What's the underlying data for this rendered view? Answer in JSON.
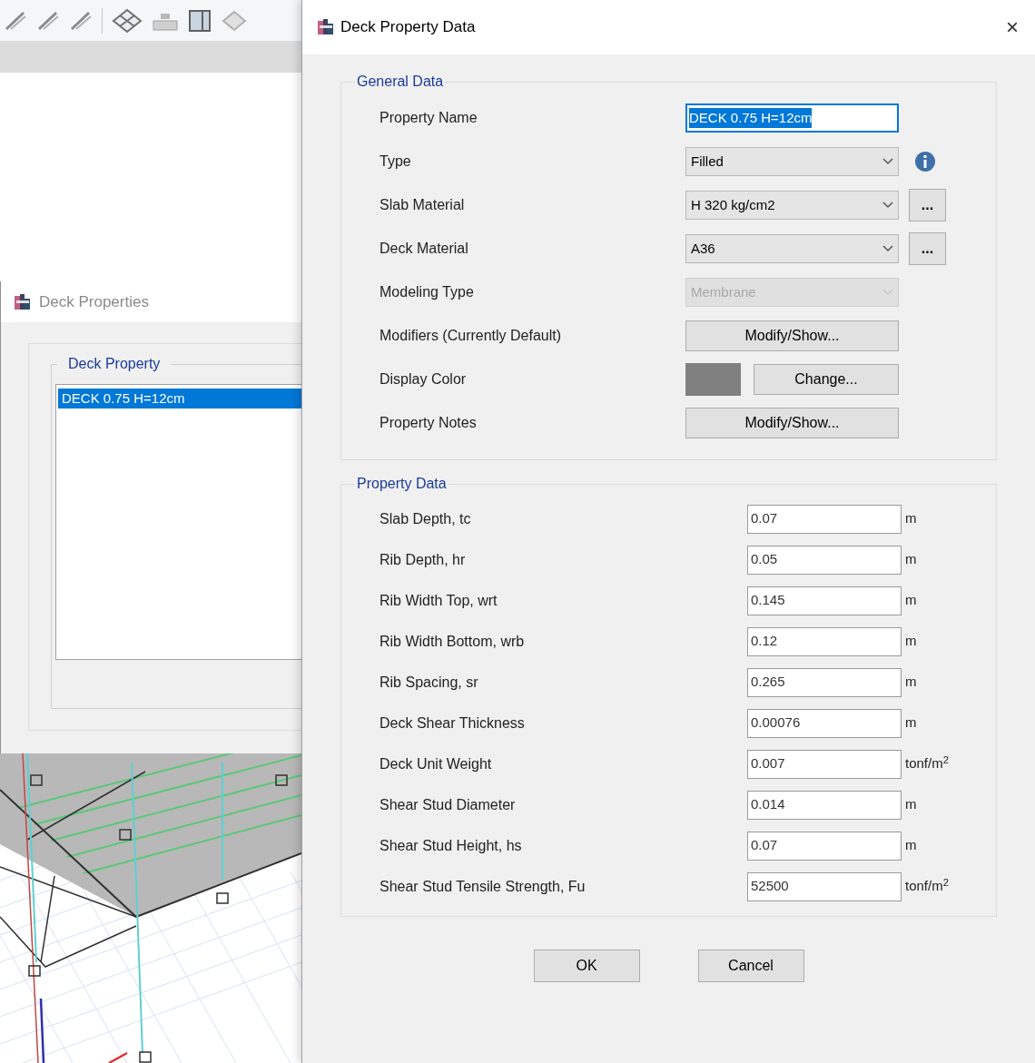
{
  "background_window": {
    "title": "Deck Properties",
    "group_title": "Deck Property",
    "items": [
      {
        "label": "DECK 0.75 H=12cm",
        "selected": true
      }
    ]
  },
  "dialog": {
    "title": "Deck Property Data",
    "close": "×",
    "general_data": {
      "title": "General Data",
      "rows": [
        {
          "kind": "text",
          "label": "Property Name",
          "value": "DECK 0.75 H=12cm",
          "selected": true
        },
        {
          "kind": "dropdown",
          "label": "Type",
          "value": "Filled",
          "disabled": false,
          "info": true
        },
        {
          "kind": "dropdown",
          "label": "Slab Material",
          "value": "H 320 kg/cm2",
          "disabled": false,
          "side_button": "..."
        },
        {
          "kind": "dropdown",
          "label": "Deck Material",
          "value": "A36",
          "disabled": false,
          "side_button": "..."
        },
        {
          "kind": "dropdown",
          "label": "Modeling Type",
          "value": "Membrane",
          "disabled": true
        },
        {
          "kind": "button",
          "label": "Modifiers (Currently Default)",
          "button": "Modify/Show..."
        },
        {
          "kind": "color",
          "label": "Display Color",
          "color": "#808080",
          "button": "Change..."
        },
        {
          "kind": "button",
          "label": "Property Notes",
          "button": "Modify/Show..."
        }
      ]
    },
    "property_data": {
      "title": "Property Data",
      "rows": [
        {
          "label": "Slab Depth, tc",
          "value": "0.07",
          "unit": "m"
        },
        {
          "label": "Rib Depth, hr",
          "value": "0.05",
          "unit": "m"
        },
        {
          "label": "Rib Width Top, wrt",
          "value": "0.145",
          "unit": "m"
        },
        {
          "label": "Rib Width Bottom, wrb",
          "value": "0.12",
          "unit": "m"
        },
        {
          "label": "Rib Spacing, sr",
          "value": "0.265",
          "unit": "m"
        },
        {
          "label": "Deck Shear Thickness",
          "value": "0.00076",
          "unit": "m"
        },
        {
          "label": "Deck Unit Weight",
          "value": "0.007",
          "unit": "tonf/m$^{2}$"
        },
        {
          "label": "Shear Stud Diameter",
          "value": "0.014",
          "unit": "m"
        },
        {
          "label": "Shear Stud Height, hs",
          "value": "0.07",
          "unit": "m"
        },
        {
          "label": "Shear Stud Tensile Strength, Fu",
          "value": "52500",
          "unit": "tonf/m$^{2}$"
        }
      ]
    },
    "buttons": [
      "OK",
      "Cancel"
    ]
  }
}
